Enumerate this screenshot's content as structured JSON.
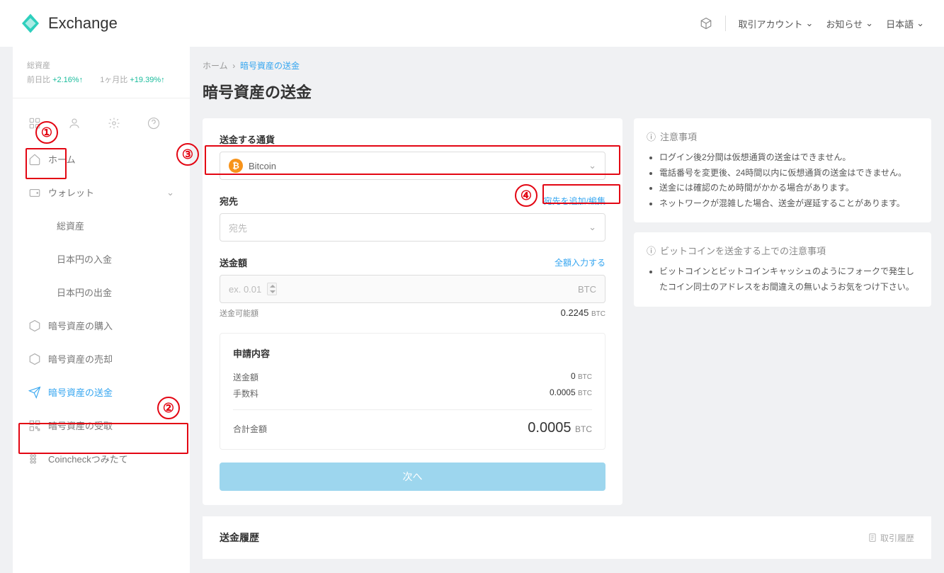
{
  "header": {
    "brand": "Exchange",
    "account": "取引アカウント",
    "notice": "お知らせ",
    "lang": "日本語"
  },
  "sidebar": {
    "total_label": "総資産",
    "day_label": "前日比",
    "day_val": "+2.16%↑",
    "month_label": "1ヶ月比",
    "month_val": "+19.39%↑",
    "items": {
      "home": "ホーム",
      "wallet": "ウォレット",
      "total_assets": "総資産",
      "jpy_deposit": "日本円の入金",
      "jpy_withdraw": "日本円の出金",
      "buy": "暗号資産の購入",
      "sell": "暗号資産の売却",
      "send": "暗号資産の送金",
      "receive": "暗号資産の受取",
      "tsumitate": "Coincheckつみたて"
    }
  },
  "crumbs": {
    "home": "ホーム",
    "current": "暗号資産の送金"
  },
  "page_title": "暗号資産の送金",
  "form": {
    "currency_label": "送金する通貨",
    "currency_value": "Bitcoin",
    "dest_label": "宛先",
    "dest_edit": "宛先を追加/編集",
    "dest_placeholder": "宛先",
    "amount_label": "送金額",
    "amount_all": "全額入力する",
    "amount_placeholder": "ex. 0.01",
    "amount_unit": "BTC",
    "available_label": "送金可能額",
    "available_value": "0.2245",
    "available_unit": "BTC"
  },
  "summary": {
    "title": "申請内容",
    "amount_label": "送金額",
    "amount_value": "0",
    "fee_label": "手数料",
    "fee_value": "0.0005",
    "total_label": "合計金額",
    "total_value": "0.0005",
    "unit": "BTC"
  },
  "next_button": "次へ",
  "notices": {
    "title1": "注意事項",
    "items1": [
      "ログイン後2分間は仮想通貨の送金はできません。",
      "電話番号を変更後、24時間以内に仮想通貨の送金はできません。",
      "送金には確認のため時間がかかる場合があります。",
      "ネットワークが混雑した場合、送金が遅延することがあります。"
    ],
    "title2": "ビットコインを送金する上での注意事項",
    "items2": [
      "ビットコインとビットコインキャッシュのようにフォークで発生したコイン同士のアドレスをお間違えの無いようお気をつけ下さい。"
    ]
  },
  "history": {
    "title": "送金履歴",
    "link": "取引履歴"
  },
  "markers": {
    "m1": "①",
    "m2": "②",
    "m3": "③",
    "m4": "④"
  }
}
